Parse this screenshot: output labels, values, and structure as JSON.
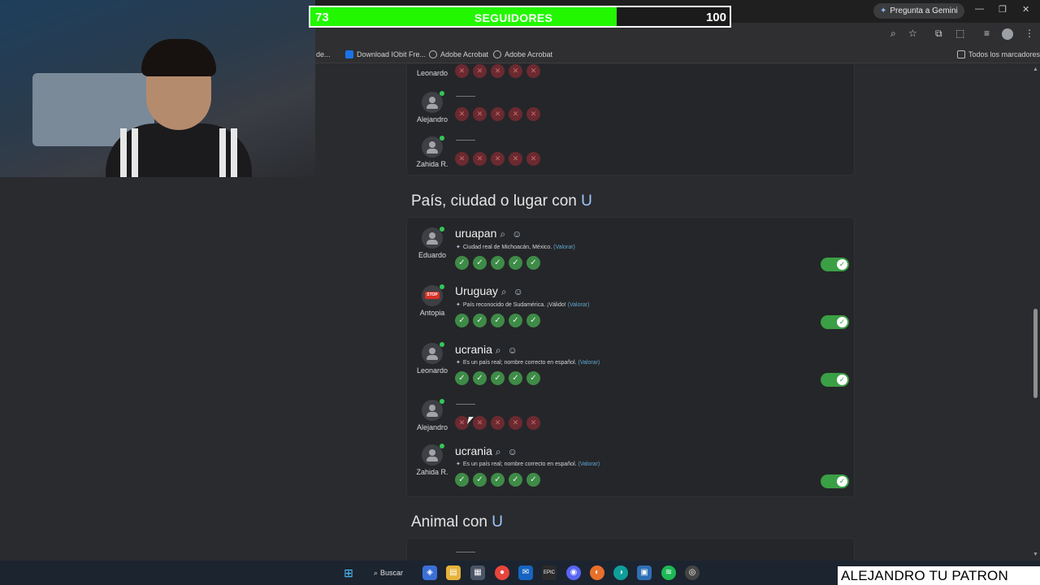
{
  "followers": {
    "current": "73",
    "label": "SEGUIDORES",
    "goal": "100",
    "fraction": 0.73,
    "fill_color": "#22f700"
  },
  "browser": {
    "gemini_label": "Pregunta a Gemini",
    "bookmarks": [
      {
        "label": "de..."
      },
      {
        "label": "Download IObit Fre..."
      },
      {
        "label": "Adobe Acrobat"
      },
      {
        "label": "Adobe Acrobat"
      }
    ],
    "all_bookmarks": "Todos los marcadores"
  },
  "top_card": {
    "players": [
      {
        "name": "Leonardo"
      },
      {
        "name": "Alejandro"
      },
      {
        "name": "Zahida R."
      }
    ]
  },
  "section_country": {
    "title_prefix": "País, ciudad o lugar con",
    "letter": "U",
    "rows": [
      {
        "player": "Eduardo",
        "answer": "uruapan",
        "note": "Ciudad real de Michoacán, México.",
        "valorar": "(Valorar)",
        "valid": true
      },
      {
        "player": "Antopia",
        "answer": "Uruguay",
        "note": "País reconocido de Sudamérica. ¡Válido!",
        "valorar": "(Valorar)",
        "valid": true
      },
      {
        "player": "Leonardo",
        "answer": "ucrania",
        "note": "Es un país real; nombre correcto en español.",
        "valorar": "(Valorar)",
        "valid": true
      },
      {
        "player": "Alejandro",
        "answer": "",
        "note": "",
        "valorar": "",
        "valid": false
      },
      {
        "player": "Zahida R.",
        "answer": "ucrania",
        "note": "Es un país real; nombre correcto en español.",
        "valorar": "(Valorar)",
        "valid": true
      }
    ]
  },
  "section_animal": {
    "title_prefix": "Animal con",
    "letter": "U"
  },
  "taskbar": {
    "search_label": "Buscar"
  },
  "caption": "ALEJANDRO TU PATRON",
  "colors": {
    "valid_green": "#3e8b47",
    "invalid_red": "#6b2a30",
    "toggle_green": "#3b9f45",
    "accent_blue": "#9ec7ff"
  }
}
